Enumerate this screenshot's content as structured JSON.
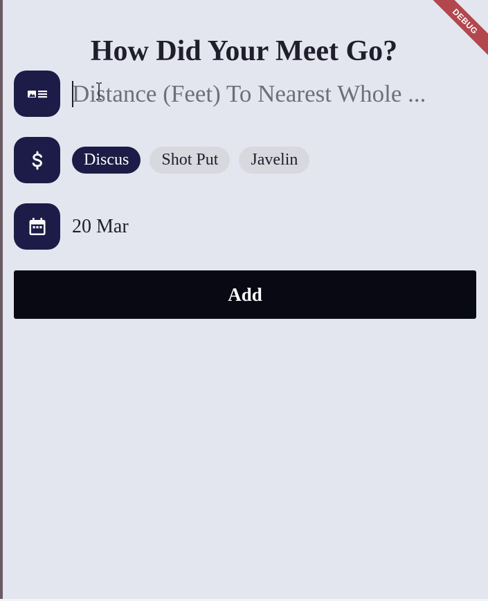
{
  "title": "How Did Your Meet Go?",
  "debug_banner": "DEBUG",
  "distance": {
    "icon": "id-card-icon",
    "value": "",
    "placeholder": "Distance (Feet) To Nearest Whole ..."
  },
  "event": {
    "icon": "dollar-icon",
    "options": [
      {
        "label": "Discus",
        "selected": true
      },
      {
        "label": "Shot Put",
        "selected": false
      },
      {
        "label": "Javelin",
        "selected": false
      }
    ]
  },
  "date": {
    "icon": "calendar-icon",
    "label": "20 Mar"
  },
  "add_label": "Add",
  "colors": {
    "background": "#e3e5ef",
    "accent": "#1d1b48",
    "button": "#090914",
    "chip": "#d8d9de",
    "debug": "#b3474e"
  }
}
